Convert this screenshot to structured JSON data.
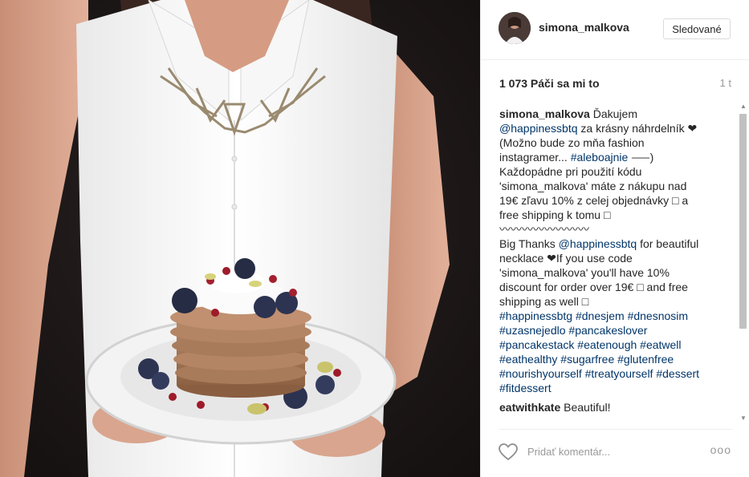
{
  "post": {
    "username": "simona_malkova",
    "follow_label": "Sledované",
    "likes": "1 073 Páči sa mi to",
    "time_ago": "1 t"
  },
  "caption": {
    "author": "simona_malkova",
    "line1": " Ďakujem",
    "mention1": "@happinessbtq",
    "line2": " za krásny náhrdelník ❤",
    "line3": "(Možno bude zo mňa fashion",
    "line4a": "instagramer... ",
    "hashtag_alebo": "#aleboajnie",
    "line4b": " ⸺)",
    "line5": "Každopádne pri použití kódu",
    "line6": "'simona_malkova' máte z nákupu nad",
    "line7": "19€ zľavu 10% z celej objednávky □ a",
    "line8": "free shipping k tomu □",
    "line9": "〰〰〰〰〰〰〰〰",
    "line10a": "Big Thanks ",
    "mention2": "@happinessbtq",
    "line10b": " for beautiful",
    "line11": "necklace ❤If you use code",
    "line12": "'simona_malkova' you'll have 10%",
    "line13": "discount for order over 19€ □ and free",
    "line14": "shipping as well □",
    "hashtags_row1": [
      "#happinessbtg",
      "#dnesjem",
      "#dnesnosim"
    ],
    "hashtags_row2": [
      "#uzasnejedlo",
      "#pancakeslover"
    ],
    "hashtags_row3": [
      "#pancakestack",
      "#eatenough",
      "#eatwell"
    ],
    "hashtags_row4": [
      "#eathealthy",
      "#sugarfree",
      "#glutenfree"
    ],
    "hashtags_row5": [
      "#nourishyourself",
      "#treatyourself",
      "#dessert"
    ],
    "hashtags_row6": [
      "#fitdessert"
    ]
  },
  "comment2": {
    "author": "eatwithkate",
    "text": " Beautiful!"
  },
  "footer": {
    "comment_placeholder": "Pridať komentár...",
    "more_label": "ooo"
  },
  "icons": {
    "like": "heart-outline-icon",
    "more": "ellipsis-icon"
  },
  "colors": {
    "link": "#003569",
    "text": "#262626",
    "muted": "#999999"
  }
}
